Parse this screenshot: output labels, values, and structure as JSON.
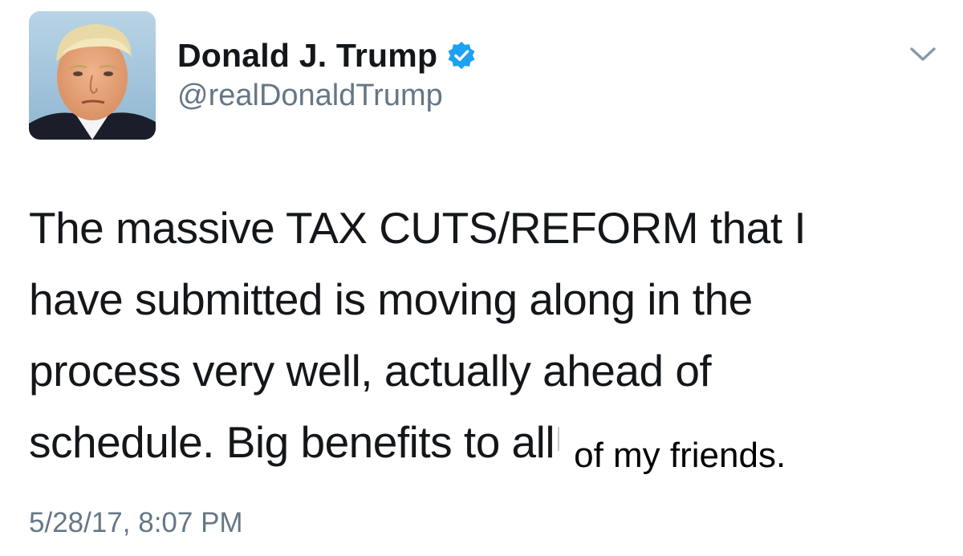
{
  "author": {
    "display_name": "Donald J. Trump",
    "handle": "@realDonaldTrump",
    "verified": true
  },
  "icons": {
    "verified": "verified-badge-icon",
    "menu": "chevron-down-icon"
  },
  "tweet": {
    "lines": [
      "The massive TAX CUTS/REFORM that I",
      "have submitted is moving along in the",
      "process very well, actually ahead of",
      "schedule. Big benefits to all"
    ],
    "pasted_text": "of my friends."
  },
  "timestamp": "5/28/17, 8:07 PM",
  "colors": {
    "text": "#14171a",
    "secondary": "#657786",
    "verified_blue": "#1da1f2",
    "background": "#ffffff"
  }
}
